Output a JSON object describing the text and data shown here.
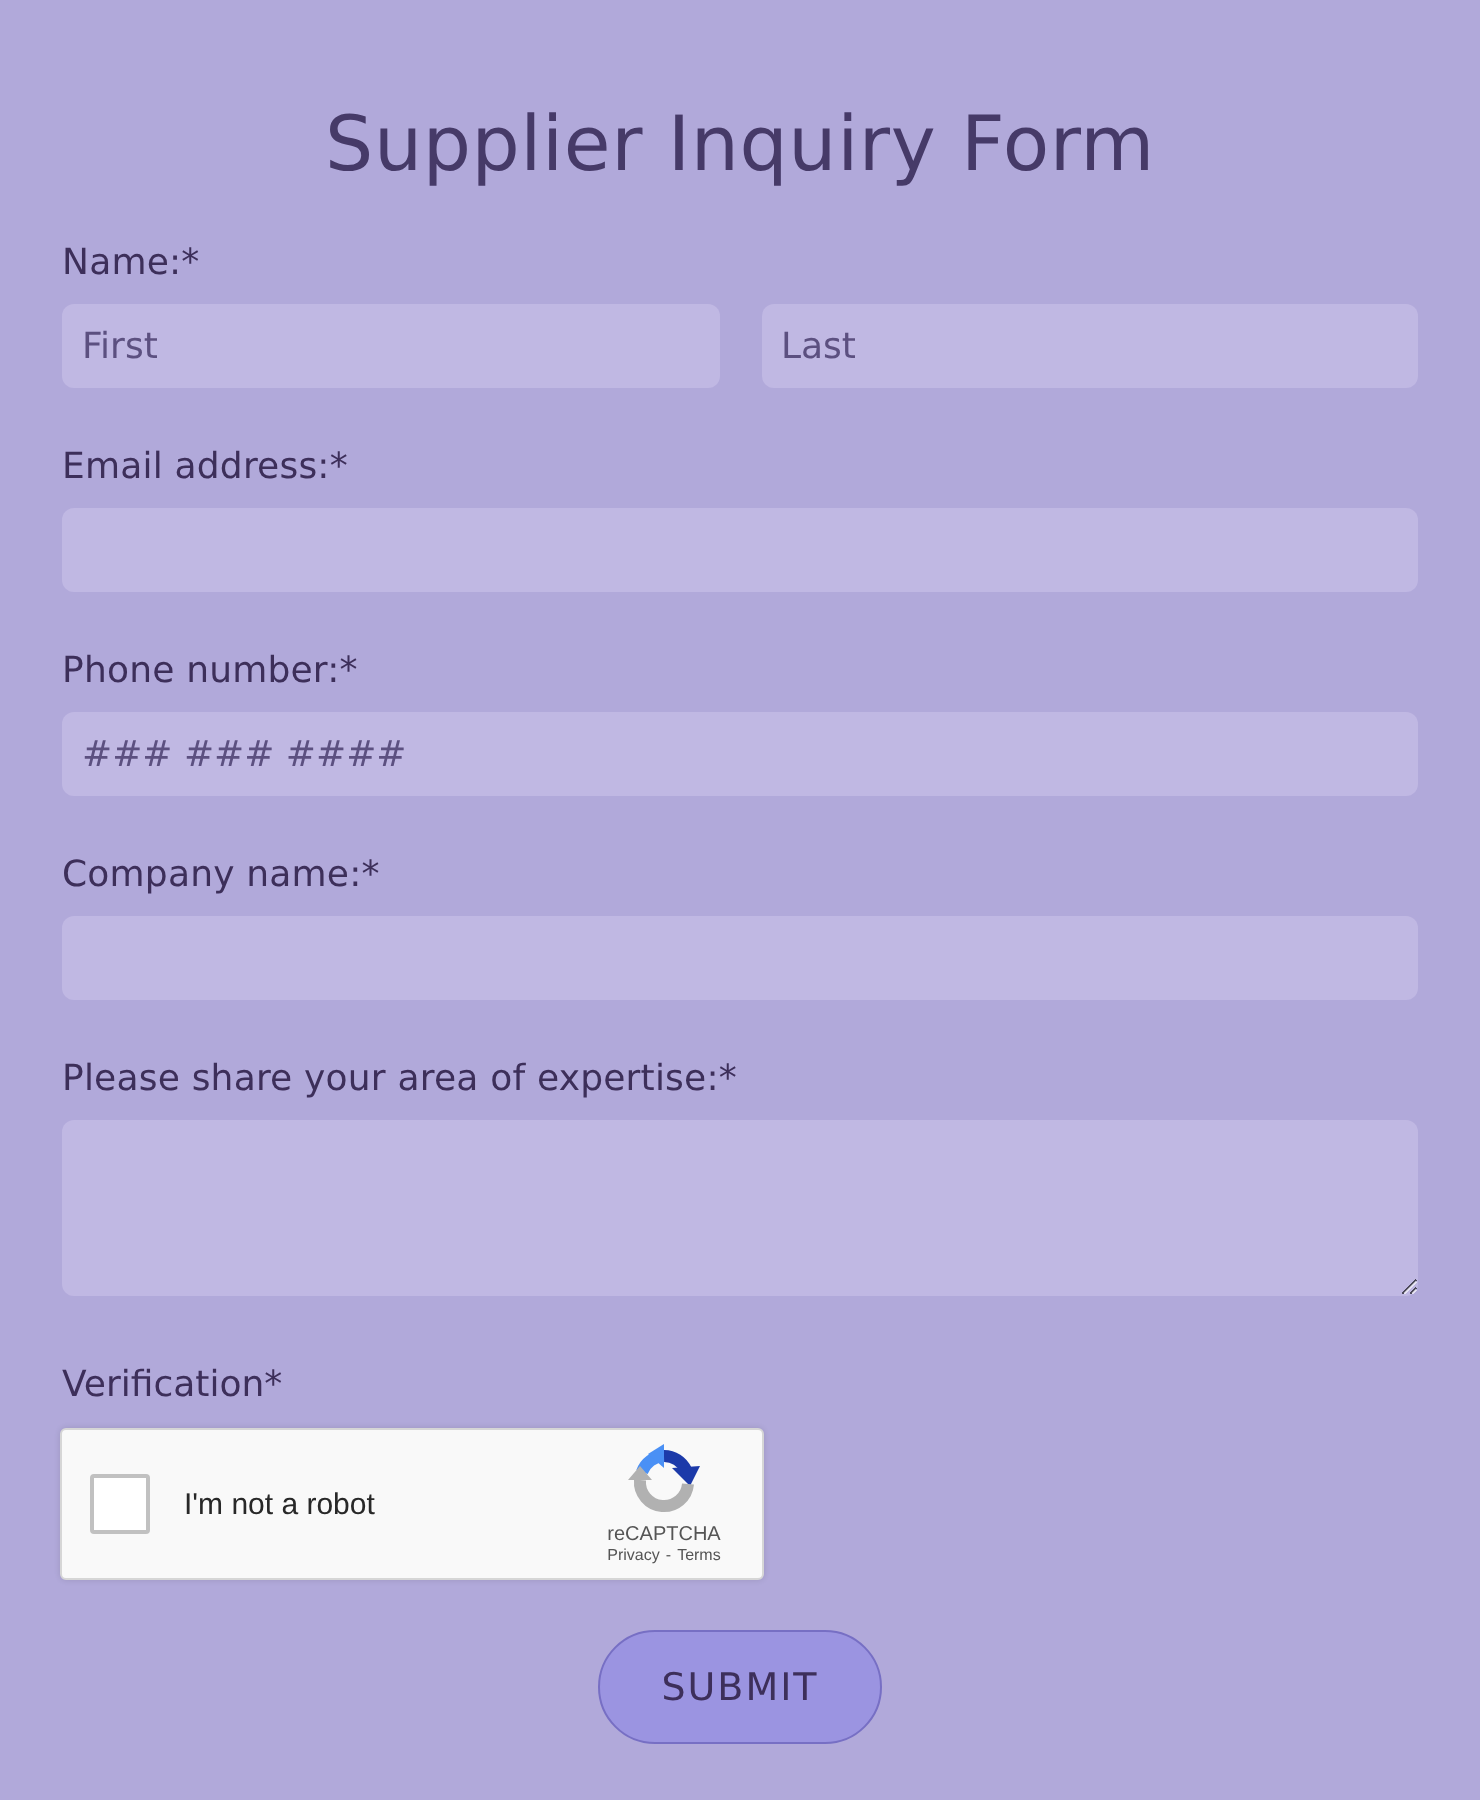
{
  "title": "Supplier Inquiry Form",
  "fields": [
    {
      "kind": "split",
      "label": "Name:*",
      "inputs": [
        {
          "placeholder": "First"
        },
        {
          "placeholder": "Last"
        }
      ]
    },
    {
      "kind": "text",
      "label": "Email address:*"
    },
    {
      "kind": "text",
      "label": "Phone number:*",
      "placeholder": "### ### ####"
    },
    {
      "kind": "text",
      "label": "Company name:*"
    },
    {
      "kind": "textarea",
      "label": "Please share your area of expertise:*"
    }
  ],
  "verification": {
    "label": "Verification*",
    "captcha": {
      "checked": false,
      "prompt": "I'm not a robot",
      "brand": "reCAPTCHA",
      "links": [
        "Privacy",
        "Terms"
      ],
      "separator": "-"
    }
  },
  "submit": "SUBMIT"
}
